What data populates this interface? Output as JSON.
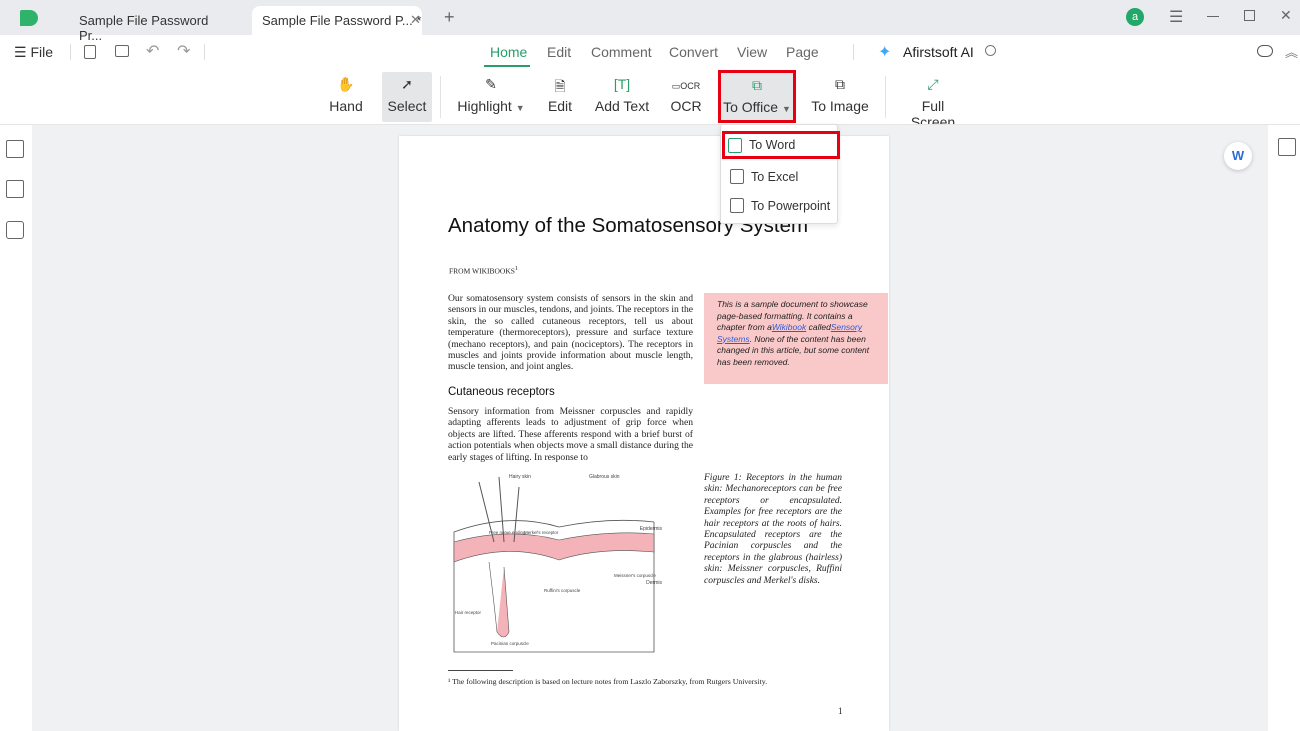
{
  "tabs": [
    {
      "label": "Sample File Password Pr..."
    },
    {
      "label": "Sample File Password P... *"
    }
  ],
  "file_label": "File",
  "menus": [
    "Home",
    "Edit",
    "Comment",
    "Convert",
    "View",
    "Page"
  ],
  "ai_label": "Afirstsoft AI",
  "avatar_letter": "a",
  "tools": [
    "Hand",
    "Select",
    "Highlight",
    "Edit",
    "Add Text",
    "OCR",
    "To Office",
    "To Image",
    "Full Screen"
  ],
  "dropdown": [
    "To Word",
    "To Excel",
    "To Powerpoint"
  ],
  "accent": "#2a9d6a",
  "highlight_color": "#e60012",
  "doc": {
    "title": "Anatomy of the Somatosensory System",
    "from": "FROM WIKIBOOKS",
    "from_sup": "1",
    "p1": "Our somatosensory system consists of sensors in the skin and sensors in our muscles, tendons, and joints. The receptors in the skin, the so called cutaneous receptors, tell us about temperature (thermoreceptors), pressure and surface texture (mechano receptors), and pain (nociceptors). The receptors in muscles and joints provide information about muscle length, muscle tension, and joint angles.",
    "note_a": "This is a sample document to showcase page-based formatting. It contains a chapter from a",
    "note_link1": "Wikibook",
    "note_b": " called",
    "note_link2": "Sensory Systems",
    "note_c": ". None of the content has been changed in this article, but some content has been removed.",
    "h2": "Cutaneous receptors",
    "p2": "Sensory information from Meissner corpuscles and rapidly adapting afferents leads to adjustment of grip force when objects are lifted. These afferents respond with a brief burst of action potentials when objects move a small distance during the early stages of lifting. In response to",
    "caption": "Figure 1: Receptors in the human skin: Mechanoreceptors can be free receptors or encapsulated. Examples for free receptors are the hair receptors at the roots of hairs. Encapsulated receptors are the Pacinian corpuscles and the receptors in the glabrous (hairless) skin: Meissner corpuscles, Ruffini corpuscles and Merkel's disks.",
    "fig_labels": [
      "Hairy skin",
      "Glabrous skin",
      "Epidermis",
      "Dermis",
      "Hair receptor",
      "Pacinian corpuscle",
      "Ruffini's corpuscle",
      "Meissner's corpuscle",
      "Free nerve ending",
      "Merkel's receptor"
    ],
    "footnote": "¹ The following description is based on lecture notes from Laszlo Zaborszky, from Rutgers University.",
    "page_number": "1"
  }
}
